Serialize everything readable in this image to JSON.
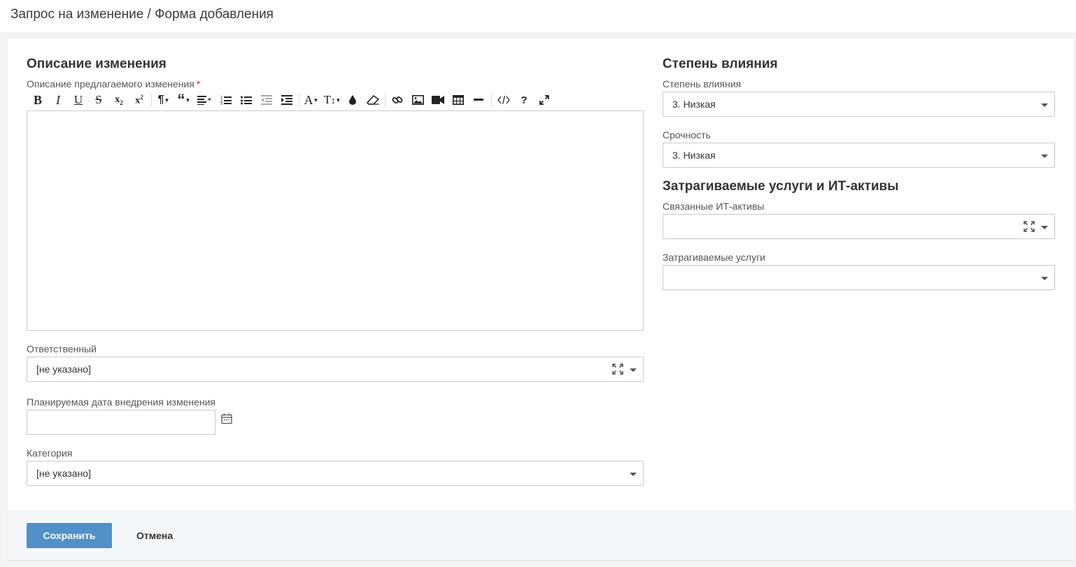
{
  "page": {
    "title": "Запрос на изменение / Форма добавления"
  },
  "left": {
    "section_title": "Описание изменения",
    "description_label": "Описание предлагаемого изменения",
    "required_mark": "*",
    "toolbar": [
      "bold-icon",
      "italic-icon",
      "underline-icon",
      "strikethrough-icon",
      "subscript-icon",
      "superscript-icon",
      "paragraph-icon",
      "quote-icon",
      "align-icon",
      "ordered-list-icon",
      "unordered-list-icon",
      "outdent-icon",
      "indent-icon",
      "font-color-icon",
      "font-size-icon",
      "color-drop-icon",
      "eraser-icon",
      "link-icon",
      "image-icon",
      "video-icon",
      "table-icon",
      "horizontal-rule-icon",
      "code-view-icon",
      "help-icon",
      "fullscreen-icon"
    ],
    "responsible_label": "Ответственный",
    "responsible_value": "[не указано]",
    "date_label": "Планируемая дата внедрения изменения",
    "date_value": "",
    "category_label": "Категория",
    "category_value": "[не указано]"
  },
  "right": {
    "impact_section_title": "Степень влияния",
    "impact_label": "Степень влияния",
    "impact_value": "3. Низкая",
    "urgency_label": "Срочность",
    "urgency_value": "3. Низкая",
    "services_section_title": "Затрагиваемые услуги и ИТ-активы",
    "assets_label": "Связанные ИТ-активы",
    "assets_value": "",
    "services_label": "Затрагиваемые услуги",
    "services_value": ""
  },
  "footer": {
    "save_label": "Сохранить",
    "cancel_label": "Отмена"
  },
  "colors": {
    "primary": "#4f91c8",
    "required": "#e02020",
    "footer_bg": "#f4f7fa"
  }
}
